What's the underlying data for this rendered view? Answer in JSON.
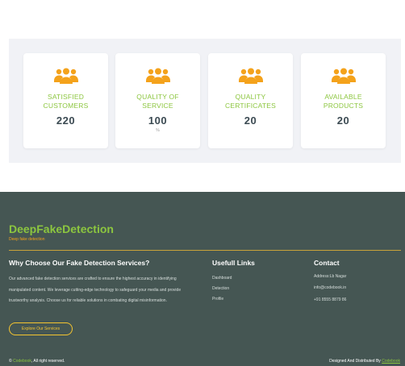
{
  "stats": [
    {
      "label": "SATISFIED\nCUSTOMERS",
      "value": "220",
      "percent": ""
    },
    {
      "label": "QUALITY OF\nSERVICE",
      "value": "100",
      "percent": "%"
    },
    {
      "label": "QUALITY\nCERTIFICATES",
      "value": "20",
      "percent": ""
    },
    {
      "label": "AVAILABLE\nPRODUCTS",
      "value": "20",
      "percent": ""
    }
  ],
  "colors": {
    "accent_green": "#8cc63f",
    "icon_orange": "#f4a21b",
    "footer_bg": "#455653",
    "cta_yellow": "#f4c430"
  },
  "footer": {
    "brand": "DeepFakeDetection",
    "tagline": "Deep fake detection",
    "about": {
      "title": "Why Choose Our Fake Detection Services?",
      "text": "Our advanced fake detection services are crafted to ensure the highest accuracy in identifying manipulated content. We leverage cutting-edge technology to safeguard your media and provide trustworthy analysis. Choose us for reliable solutions in combating digital misinformation.",
      "cta": "Explore Our Services"
    },
    "links": {
      "title": "Usefull Links",
      "items": [
        "Dashboard",
        "Detection",
        "Profile"
      ]
    },
    "contact": {
      "title": "Contact",
      "address": "Address:Lb Nagar",
      "email": "info@codebook.in",
      "phone": "+91 8555 8879 86"
    },
    "copyright": {
      "symbol": "©",
      "brand": "Codebook",
      "text": ", All right reserved."
    },
    "credit": {
      "text": "Designed And Distributed By",
      "brand": "Codebook"
    }
  }
}
